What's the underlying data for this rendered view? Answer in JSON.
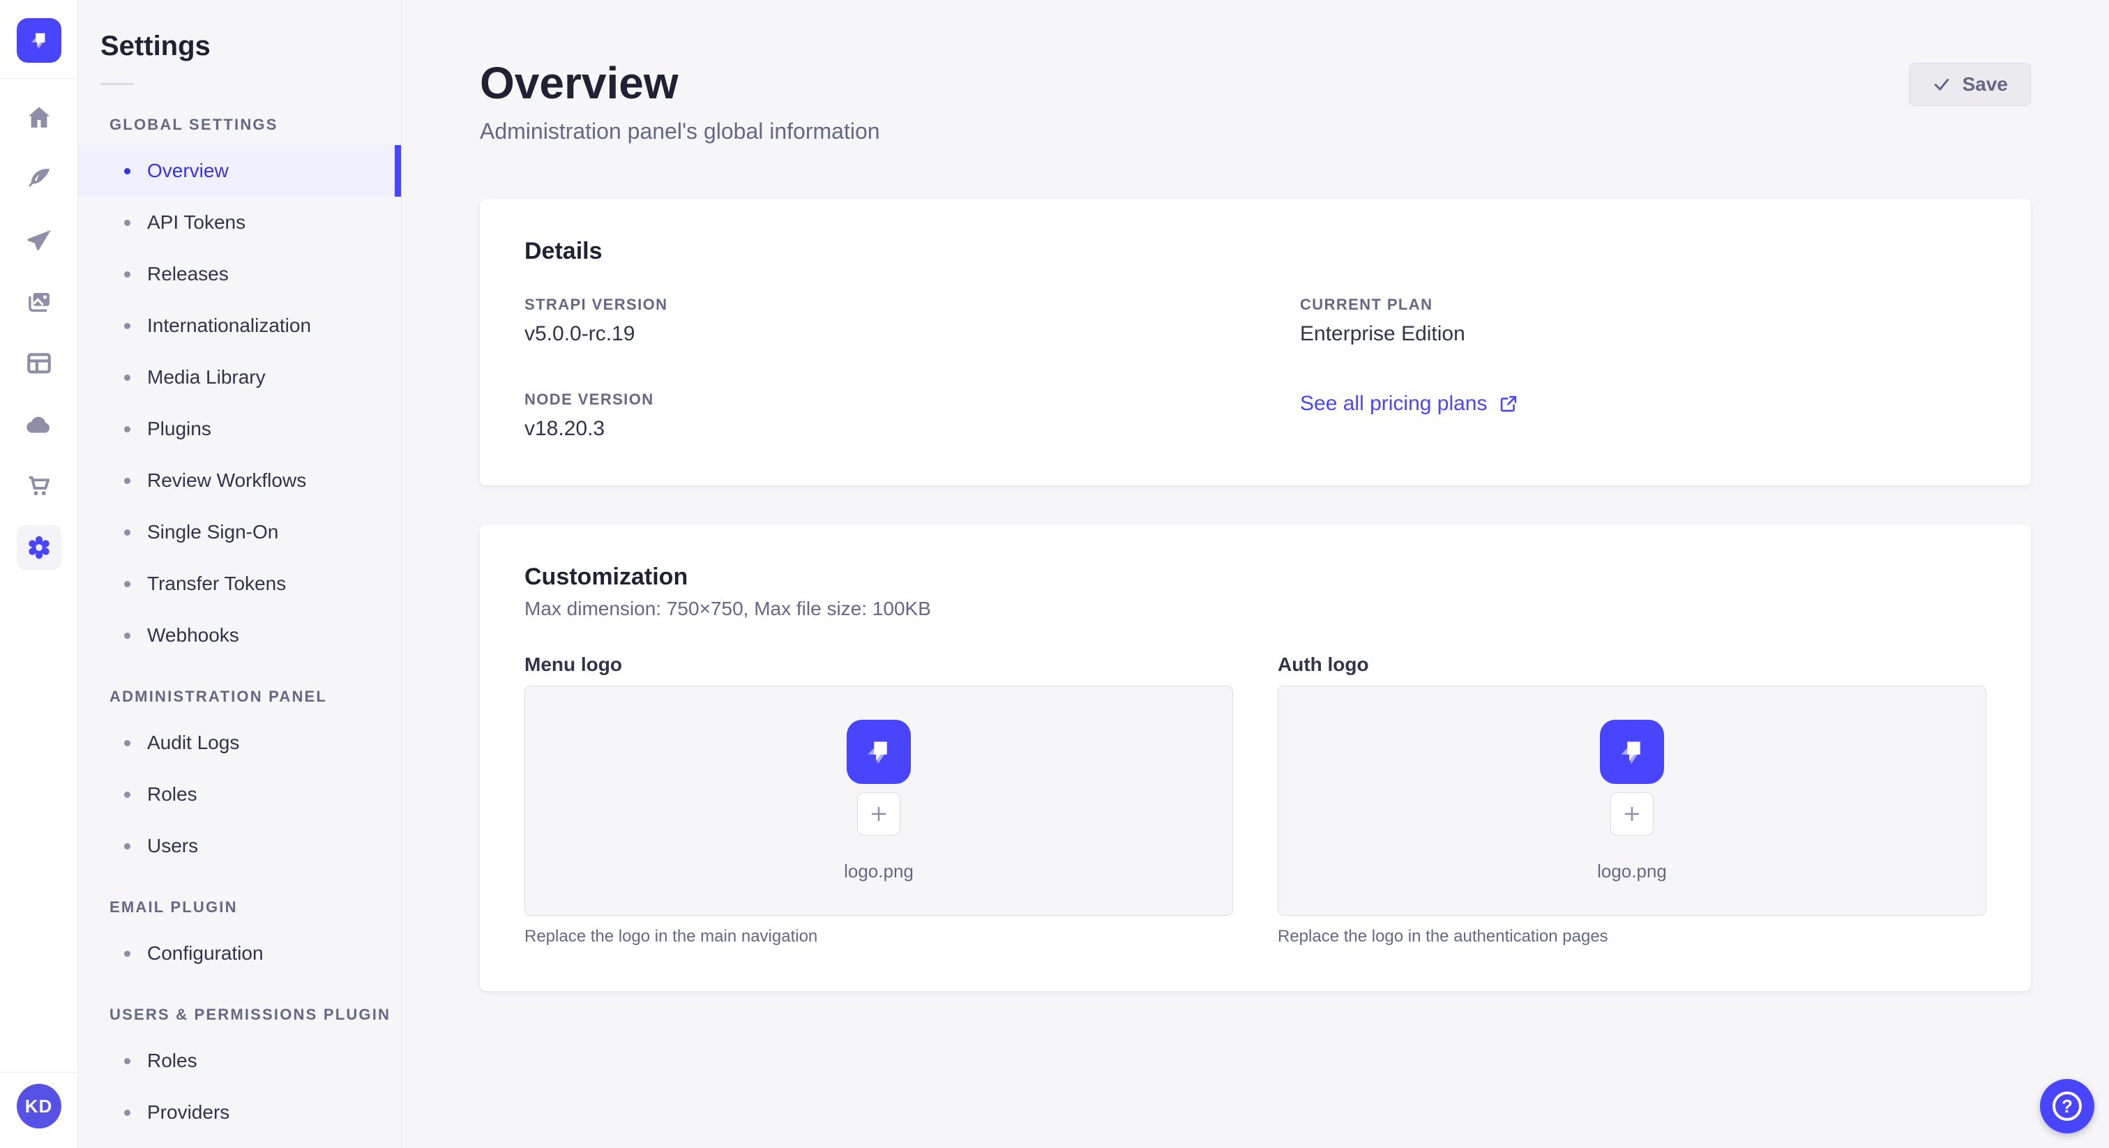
{
  "colors": {
    "primary": "#4945ff",
    "primary_dark": "#3732e5",
    "active_bg": "#f0f0ff",
    "text": "#32324d",
    "subtle": "#666687",
    "border": "#dcdce4",
    "background": "#f6f6f9"
  },
  "rail": {
    "logo_icon": "strapi-logo-icon",
    "icons": [
      "home-icon",
      "feather-icon",
      "paper-plane-icon",
      "pictures-icon",
      "layout-icon",
      "cloud-icon",
      "cart-icon",
      "gear-icon"
    ],
    "active_icon": "gear-icon",
    "avatar_initials": "KD"
  },
  "subnav": {
    "title": "Settings",
    "sections": [
      {
        "label": "GLOBAL SETTINGS",
        "items": [
          {
            "label": "Overview",
            "active": true
          },
          {
            "label": "API Tokens",
            "active": false
          },
          {
            "label": "Releases",
            "active": false
          },
          {
            "label": "Internationalization",
            "active": false
          },
          {
            "label": "Media Library",
            "active": false
          },
          {
            "label": "Plugins",
            "active": false
          },
          {
            "label": "Review Workflows",
            "active": false
          },
          {
            "label": "Single Sign-On",
            "active": false
          },
          {
            "label": "Transfer Tokens",
            "active": false
          },
          {
            "label": "Webhooks",
            "active": false
          }
        ]
      },
      {
        "label": "ADMINISTRATION PANEL",
        "items": [
          {
            "label": "Audit Logs",
            "active": false
          },
          {
            "label": "Roles",
            "active": false
          },
          {
            "label": "Users",
            "active": false
          }
        ]
      },
      {
        "label": "EMAIL PLUGIN",
        "items": [
          {
            "label": "Configuration",
            "active": false
          }
        ]
      },
      {
        "label": "USERS & PERMISSIONS PLUGIN",
        "items": [
          {
            "label": "Roles",
            "active": false
          },
          {
            "label": "Providers",
            "active": false
          }
        ]
      }
    ]
  },
  "main": {
    "header": {
      "title": "Overview",
      "subtitle": "Administration panel's global information",
      "save_label": "Save"
    },
    "details": {
      "title": "Details",
      "strapi_version": {
        "label": "STRAPI VERSION",
        "value": "v5.0.0-rc.19"
      },
      "node_version": {
        "label": "NODE VERSION",
        "value": "v18.20.3"
      },
      "current_plan": {
        "label": "CURRENT PLAN",
        "value": "Enterprise Edition"
      },
      "pricing_link": "See all pricing plans"
    },
    "customization": {
      "title": "Customization",
      "subtitle": "Max dimension: 750×750, Max file size: 100KB",
      "logos": [
        {
          "label": "Menu logo",
          "filename": "logo.png",
          "hint": "Replace the logo in the main navigation"
        },
        {
          "label": "Auth logo",
          "filename": "logo.png",
          "hint": "Replace the logo in the authentication pages"
        }
      ]
    }
  },
  "help_button": {
    "icon": "question-mark-icon"
  }
}
